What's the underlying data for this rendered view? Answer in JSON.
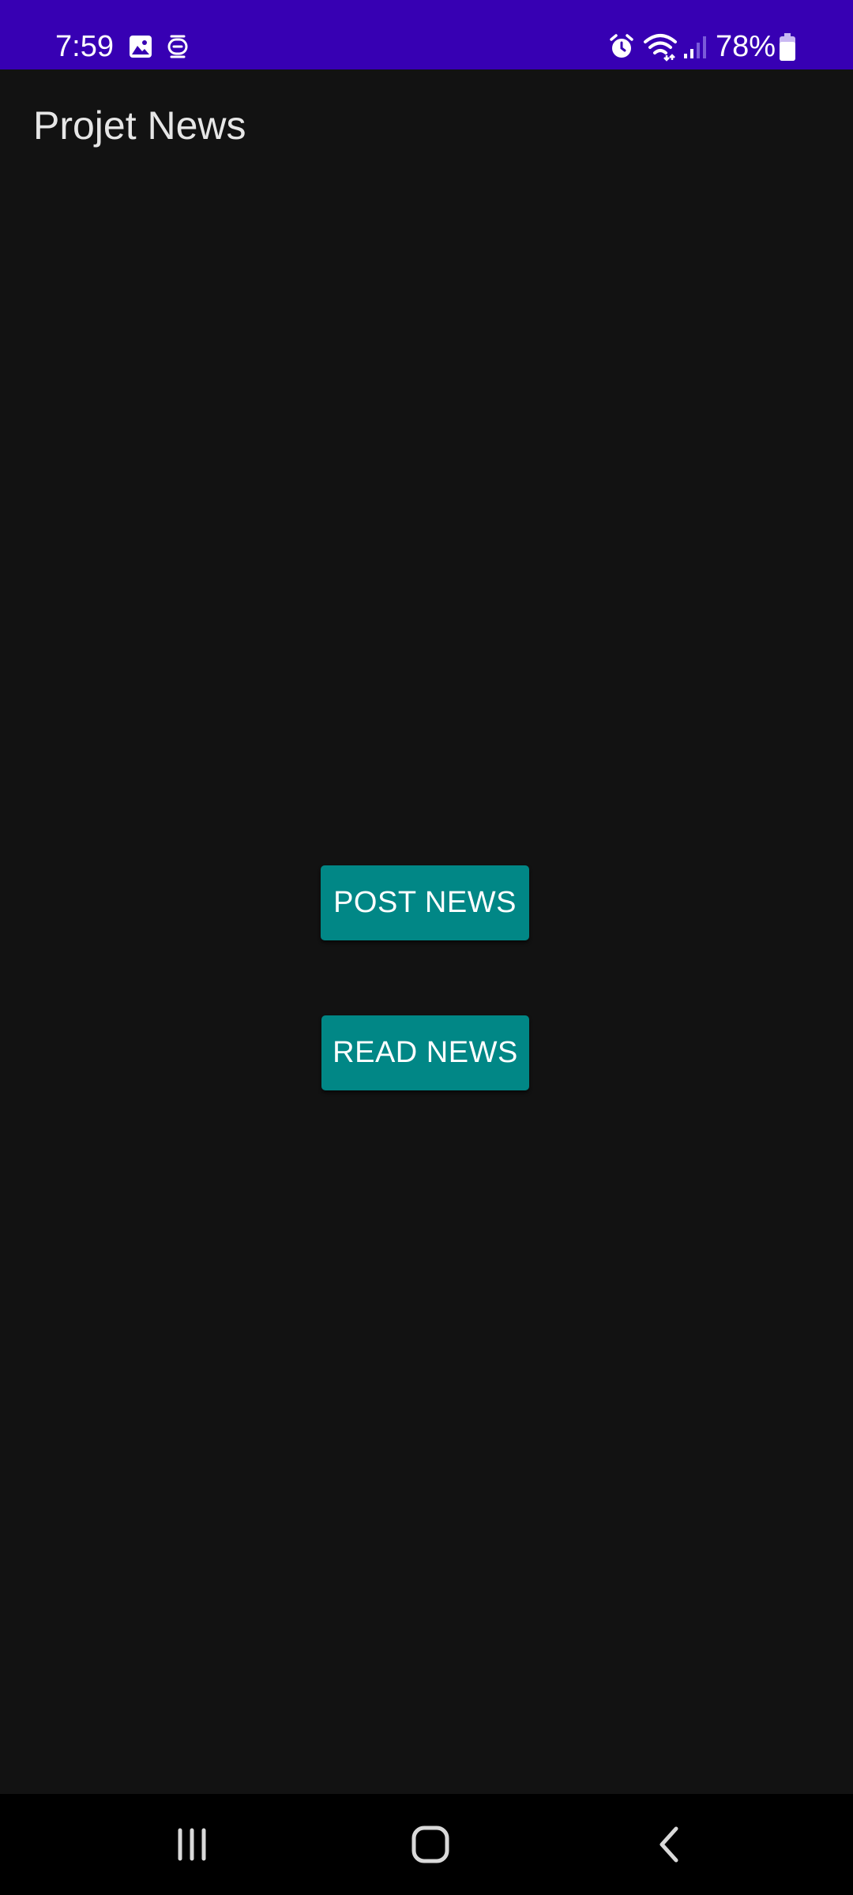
{
  "status_bar": {
    "time": "7:59",
    "battery_percent": "78%",
    "background_color": "#3700b3",
    "icons": [
      "image-icon",
      "screenshot-icon",
      "alarm-icon",
      "wifi-icon",
      "signal-icon",
      "battery-icon"
    ],
    "battery_level": 0.78
  },
  "app_bar": {
    "title": "Projet News"
  },
  "main": {
    "post_button_label": "POST NEWS",
    "read_button_label": "READ NEWS",
    "button_color": "#018786",
    "background_color": "#121212"
  },
  "nav_bar": {
    "icons": [
      "recent-apps-icon",
      "home-icon",
      "back-icon"
    ]
  }
}
